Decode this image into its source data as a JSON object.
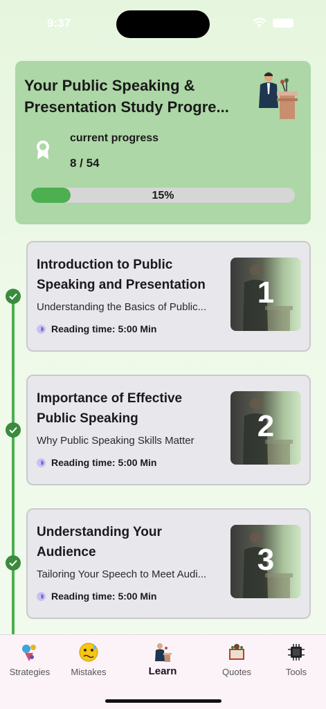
{
  "status_bar": {
    "time": "9:37"
  },
  "progress_card": {
    "title_line1": "Your Public Speaking &",
    "title_line2": "Presentation Study Progre...",
    "current_progress_label": "current progress",
    "progress_count": "8 / 54",
    "progress_percent_text": "15%",
    "progress_fraction": 0.15,
    "accent_color": "#4caf50",
    "card_color": "#add7a6"
  },
  "lessons": [
    {
      "title": "Introduction to Public Speaking and Presentation",
      "subtitle": "Understanding the Basics of Public...",
      "reading_time": "Reading time: 5:00 Min",
      "number": "1",
      "completed": true
    },
    {
      "title": "Importance of Effective Public Speaking",
      "subtitle": "Why Public Speaking Skills Matter",
      "reading_time": "Reading time: 5:00 Min",
      "number": "2",
      "completed": true
    },
    {
      "title": "Understanding Your Audience",
      "subtitle": "Tailoring Your Speech to Meet Audi...",
      "reading_time": "Reading time: 5:00 Min",
      "number": "3",
      "completed": true
    }
  ],
  "tab_bar": {
    "active": "Learn",
    "items": [
      {
        "label": "Strategies",
        "icon": "strategies-icon"
      },
      {
        "label": "Mistakes",
        "icon": "mistakes-icon"
      },
      {
        "label": "Learn",
        "icon": "learn-icon"
      },
      {
        "label": "Quotes",
        "icon": "quotes-icon"
      },
      {
        "label": "Tools",
        "icon": "tools-icon"
      }
    ]
  }
}
